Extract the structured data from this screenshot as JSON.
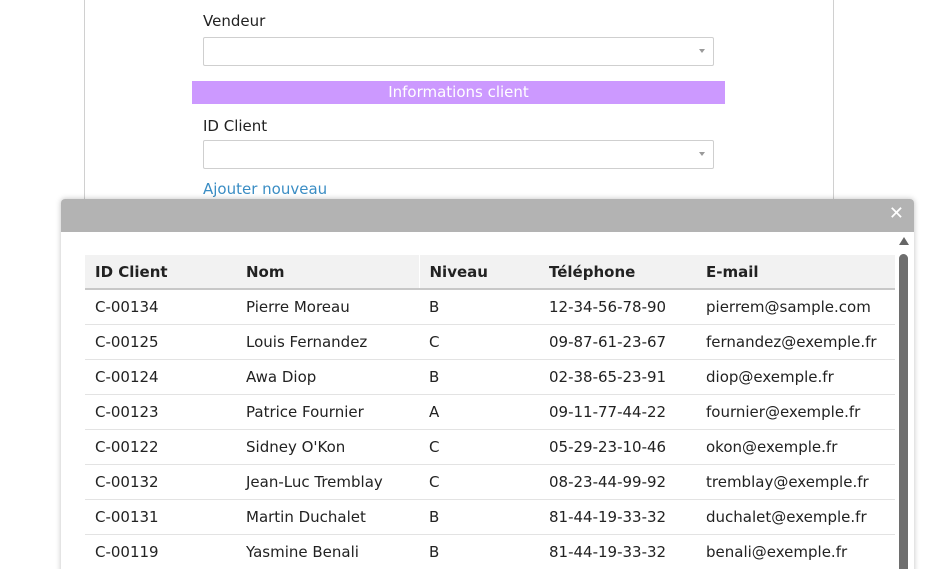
{
  "form": {
    "vendeur_label": "Vendeur",
    "vendeur_value": "",
    "section_title": "Informations client",
    "id_client_label": "ID Client",
    "id_client_value": "",
    "add_link": "Ajouter nouveau"
  },
  "modal": {
    "close_label": "✕",
    "columns": [
      "ID Client",
      "Nom",
      "Niveau",
      "Téléphone",
      "E-mail"
    ],
    "rows": [
      [
        "C-00134",
        "Pierre Moreau",
        "B",
        "12-34-56-78-90",
        "pierrem@sample.com"
      ],
      [
        "C-00125",
        "Louis Fernandez",
        "C",
        "09-87-61-23-67",
        "fernandez@exemple.fr"
      ],
      [
        "C-00124",
        "Awa Diop",
        "B",
        "02-38-65-23-91",
        "diop@exemple.fr"
      ],
      [
        "C-00123",
        "Patrice Fournier",
        "A",
        "09-11-77-44-22",
        "fournier@exemple.fr"
      ],
      [
        "C-00122",
        "Sidney O'Kon",
        "C",
        "05-29-23-10-46",
        "okon@exemple.fr"
      ],
      [
        "C-00132",
        "Jean-Luc Tremblay",
        "C",
        "08-23-44-99-92",
        "tremblay@exemple.fr"
      ],
      [
        "C-00131",
        "Martin Duchalet",
        "B",
        "81-44-19-33-32",
        "duchalet@exemple.fr"
      ],
      [
        "C-00119",
        "Yasmine Benali",
        "B",
        "81-44-19-33-32",
        "benali@exemple.fr"
      ]
    ]
  },
  "colors": {
    "section_bar": "#cc99ff",
    "modal_header": "#b3b3b3",
    "link": "#3a8dc4"
  }
}
